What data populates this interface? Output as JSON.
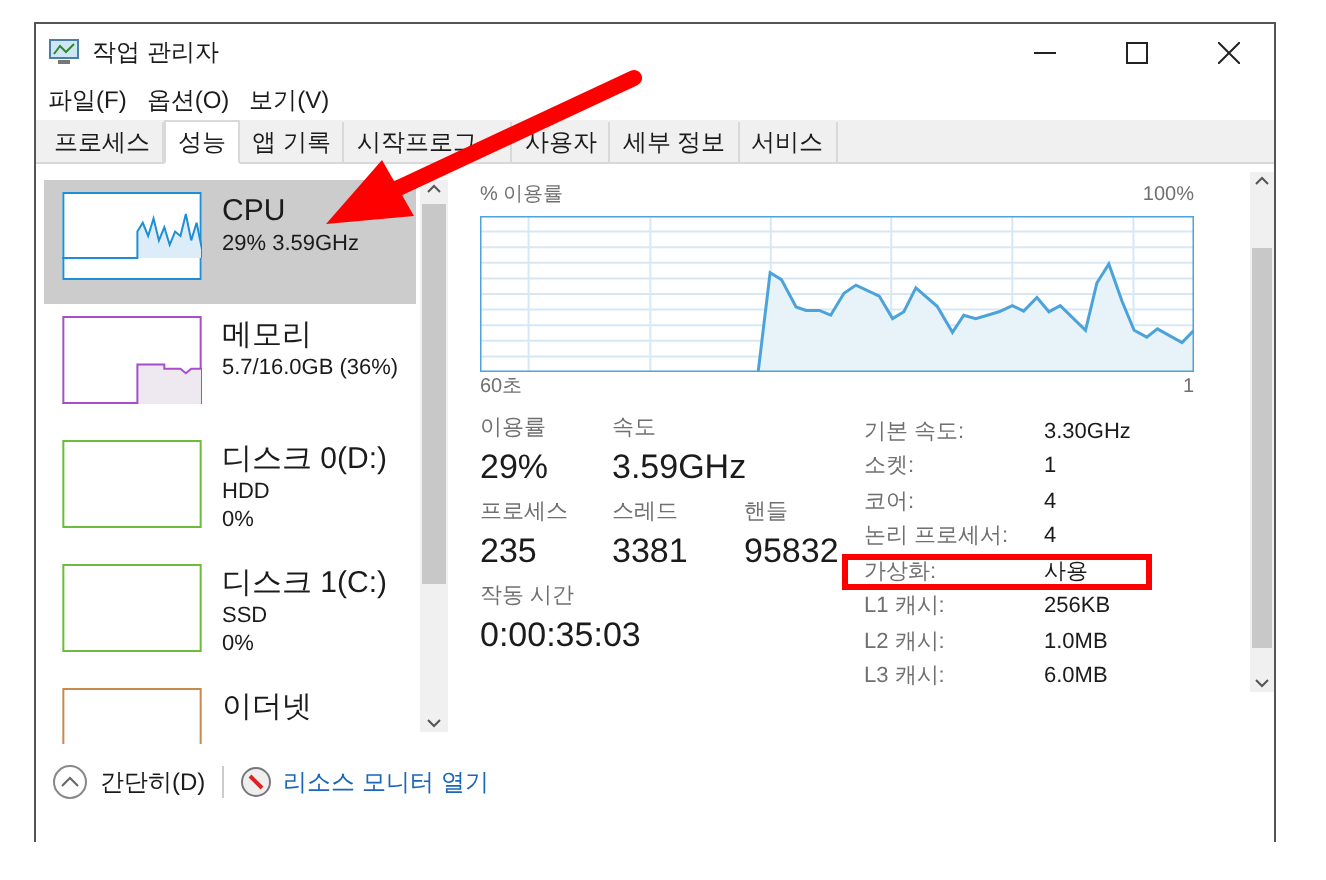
{
  "window": {
    "title": "작업 관리자"
  },
  "menu": [
    "파일(F)",
    "옵션(O)",
    "보기(V)"
  ],
  "tabs": [
    {
      "label": "프로세스",
      "selected": false
    },
    {
      "label": "성능",
      "selected": true
    },
    {
      "label": "앱 기록",
      "selected": false
    },
    {
      "label": "시작프로그",
      "selected": false
    },
    {
      "label": "사용자",
      "selected": false
    },
    {
      "label": "세부 정보",
      "selected": false
    },
    {
      "label": "서비스",
      "selected": false
    }
  ],
  "sidebar": {
    "items": [
      {
        "name": "CPU",
        "details": [
          "29% 3.59GHz"
        ],
        "color": "#1e8fd5",
        "selected": true
      },
      {
        "name": "메모리",
        "details": [
          "5.7/16.0GB (36%)"
        ],
        "color": "#a64fc8",
        "selected": false
      },
      {
        "name": "디스크 0(D:)",
        "details": [
          "HDD",
          "0%"
        ],
        "color": "#6abc3a",
        "selected": false
      },
      {
        "name": "디스크 1(C:)",
        "details": [
          "SSD",
          "0%"
        ],
        "color": "#6abc3a",
        "selected": false
      },
      {
        "name": "이더넷",
        "color": "#c58a4f",
        "selected": false
      }
    ]
  },
  "graph": {
    "title": "% 이용률",
    "max_label": "100%",
    "x_start": "60초",
    "x_end": "1"
  },
  "stats": [
    [
      {
        "label": "이용률",
        "value": "29%"
      },
      {
        "label": "속도",
        "value": "3.59GHz"
      }
    ],
    [
      {
        "label": "프로세스",
        "value": "235"
      },
      {
        "label": "스레드",
        "value": "3381"
      },
      {
        "label": "핸들",
        "value": "95832"
      }
    ],
    [
      {
        "label": "작동 시간",
        "value": "0:00:35:03"
      }
    ]
  ],
  "details": [
    {
      "label": "기본 속도:",
      "value": "3.30GHz",
      "highlighted": false
    },
    {
      "label": "소켓:",
      "value": "1",
      "highlighted": false
    },
    {
      "label": "코어:",
      "value": "4",
      "highlighted": false
    },
    {
      "label": "논리 프로세서:",
      "value": "4",
      "highlighted": false
    },
    {
      "label": "가상화:",
      "value": "사용",
      "highlighted": true
    },
    {
      "label": "L1 캐시:",
      "value": "256KB",
      "highlighted": false
    },
    {
      "label": "L2 캐시:",
      "value": "1.0MB",
      "highlighted": false
    },
    {
      "label": "L3 캐시:",
      "value": "6.0MB",
      "highlighted": false
    }
  ],
  "footer": {
    "collapse": "간단히(D)",
    "link": "리소스 모니터 열기"
  }
}
